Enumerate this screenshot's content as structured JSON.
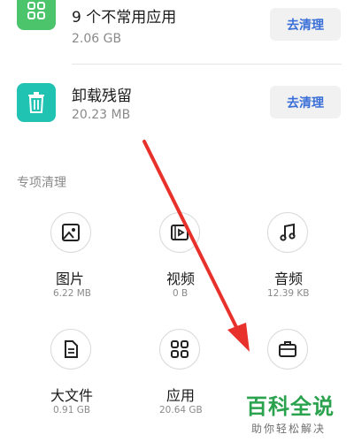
{
  "app_rows": [
    {
      "title": "9 个不常用应用",
      "size": "2.06 GB",
      "button": "去清理",
      "icon": "grid-icon",
      "color": "#4cc46c"
    },
    {
      "title": "卸载残留",
      "size": "20.23 MB",
      "button": "去清理",
      "icon": "trash-icon",
      "color": "#20c2b2"
    }
  ],
  "section_title": "专项清理",
  "categories": [
    {
      "label": "图片",
      "size": "6.22 MB",
      "icon": "image-icon"
    },
    {
      "label": "视频",
      "size": "0 B",
      "icon": "video-icon"
    },
    {
      "label": "音频",
      "size": "12.39 KB",
      "icon": "music-icon"
    },
    {
      "label": "大文件",
      "size": "0.91 GB",
      "icon": "file-icon"
    },
    {
      "label": "应用",
      "size": "20.64 GB",
      "icon": "apps-grid-icon"
    },
    {
      "label": "",
      "size": "",
      "icon": "briefcase-icon"
    }
  ],
  "watermark": {
    "title": "百科全说",
    "subtitle": "助你轻松解决"
  },
  "colors": {
    "accent_blue": "#3b6fd8",
    "arrow_red": "#e8312a",
    "watermark_green": "#2aa24e"
  }
}
